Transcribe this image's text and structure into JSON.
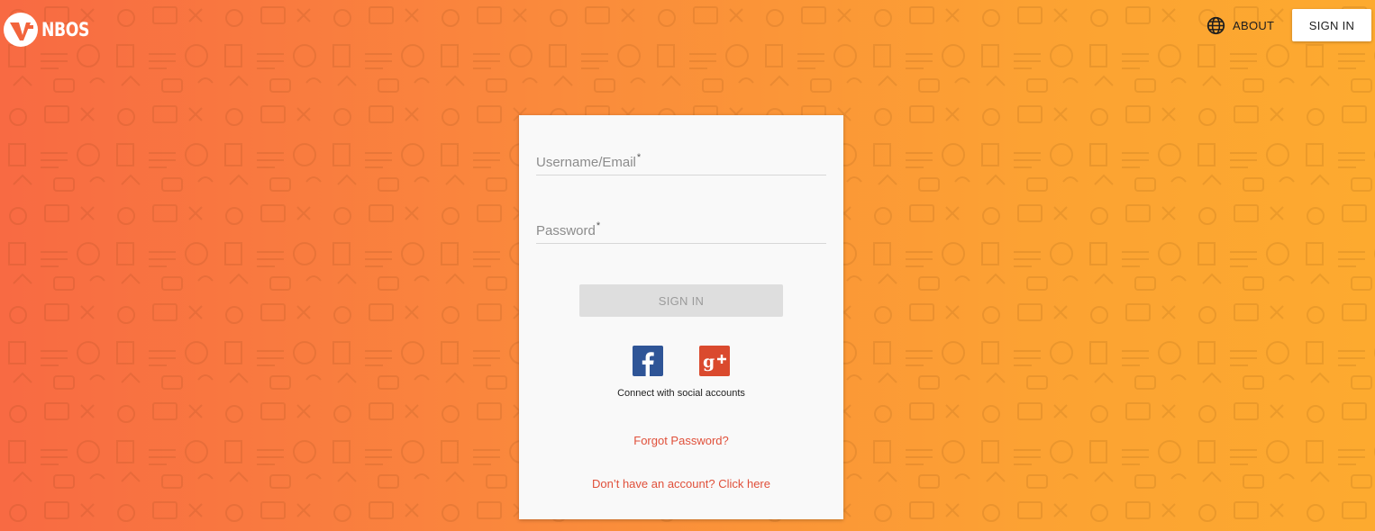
{
  "header": {
    "logo_text": "NBOS",
    "about_label": "ABOUT",
    "signin_label": "SIGN IN"
  },
  "login": {
    "username_label": "Username/Email",
    "password_label": "Password",
    "required_mark": "*",
    "signin_label": "SIGN IN",
    "social_caption": "Connect with social accounts",
    "forgot_label": "Forgot Password?",
    "signup_label": "Don’t have an account? Click here"
  },
  "icons": {
    "about": "globe-icon",
    "facebook": "facebook-icon",
    "google_plus": "google-plus-icon",
    "logo": "logo-icon"
  },
  "colors": {
    "gradient_start": "#f86a43",
    "gradient_end": "#fdaa2f",
    "link": "#e0503a",
    "facebook": "#2f5597",
    "google_plus": "#da4a2e",
    "disabled_button": "#dedede"
  }
}
